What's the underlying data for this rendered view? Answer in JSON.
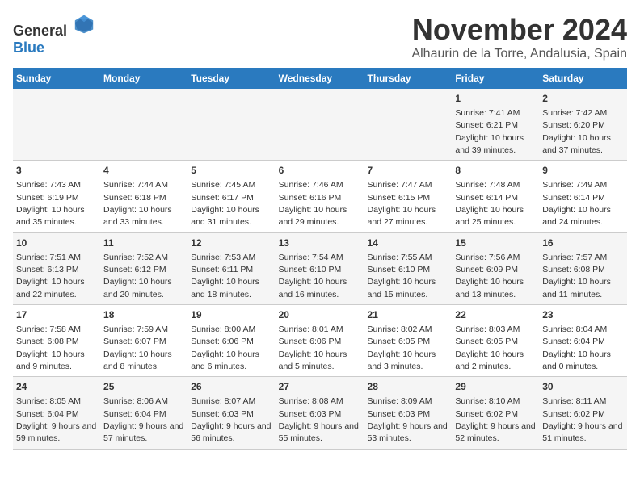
{
  "header": {
    "logo_general": "General",
    "logo_blue": "Blue",
    "month_title": "November 2024",
    "location": "Alhaurin de la Torre, Andalusia, Spain"
  },
  "columns": [
    "Sunday",
    "Monday",
    "Tuesday",
    "Wednesday",
    "Thursday",
    "Friday",
    "Saturday"
  ],
  "weeks": [
    {
      "cells": [
        {
          "day": "",
          "info": ""
        },
        {
          "day": "",
          "info": ""
        },
        {
          "day": "",
          "info": ""
        },
        {
          "day": "",
          "info": ""
        },
        {
          "day": "",
          "info": ""
        },
        {
          "day": "1",
          "info": "Sunrise: 7:41 AM\nSunset: 6:21 PM\nDaylight: 10 hours and 39 minutes."
        },
        {
          "day": "2",
          "info": "Sunrise: 7:42 AM\nSunset: 6:20 PM\nDaylight: 10 hours and 37 minutes."
        }
      ]
    },
    {
      "cells": [
        {
          "day": "3",
          "info": "Sunrise: 7:43 AM\nSunset: 6:19 PM\nDaylight: 10 hours and 35 minutes."
        },
        {
          "day": "4",
          "info": "Sunrise: 7:44 AM\nSunset: 6:18 PM\nDaylight: 10 hours and 33 minutes."
        },
        {
          "day": "5",
          "info": "Sunrise: 7:45 AM\nSunset: 6:17 PM\nDaylight: 10 hours and 31 minutes."
        },
        {
          "day": "6",
          "info": "Sunrise: 7:46 AM\nSunset: 6:16 PM\nDaylight: 10 hours and 29 minutes."
        },
        {
          "day": "7",
          "info": "Sunrise: 7:47 AM\nSunset: 6:15 PM\nDaylight: 10 hours and 27 minutes."
        },
        {
          "day": "8",
          "info": "Sunrise: 7:48 AM\nSunset: 6:14 PM\nDaylight: 10 hours and 25 minutes."
        },
        {
          "day": "9",
          "info": "Sunrise: 7:49 AM\nSunset: 6:14 PM\nDaylight: 10 hours and 24 minutes."
        }
      ]
    },
    {
      "cells": [
        {
          "day": "10",
          "info": "Sunrise: 7:51 AM\nSunset: 6:13 PM\nDaylight: 10 hours and 22 minutes."
        },
        {
          "day": "11",
          "info": "Sunrise: 7:52 AM\nSunset: 6:12 PM\nDaylight: 10 hours and 20 minutes."
        },
        {
          "day": "12",
          "info": "Sunrise: 7:53 AM\nSunset: 6:11 PM\nDaylight: 10 hours and 18 minutes."
        },
        {
          "day": "13",
          "info": "Sunrise: 7:54 AM\nSunset: 6:10 PM\nDaylight: 10 hours and 16 minutes."
        },
        {
          "day": "14",
          "info": "Sunrise: 7:55 AM\nSunset: 6:10 PM\nDaylight: 10 hours and 15 minutes."
        },
        {
          "day": "15",
          "info": "Sunrise: 7:56 AM\nSunset: 6:09 PM\nDaylight: 10 hours and 13 minutes."
        },
        {
          "day": "16",
          "info": "Sunrise: 7:57 AM\nSunset: 6:08 PM\nDaylight: 10 hours and 11 minutes."
        }
      ]
    },
    {
      "cells": [
        {
          "day": "17",
          "info": "Sunrise: 7:58 AM\nSunset: 6:08 PM\nDaylight: 10 hours and 9 minutes."
        },
        {
          "day": "18",
          "info": "Sunrise: 7:59 AM\nSunset: 6:07 PM\nDaylight: 10 hours and 8 minutes."
        },
        {
          "day": "19",
          "info": "Sunrise: 8:00 AM\nSunset: 6:06 PM\nDaylight: 10 hours and 6 minutes."
        },
        {
          "day": "20",
          "info": "Sunrise: 8:01 AM\nSunset: 6:06 PM\nDaylight: 10 hours and 5 minutes."
        },
        {
          "day": "21",
          "info": "Sunrise: 8:02 AM\nSunset: 6:05 PM\nDaylight: 10 hours and 3 minutes."
        },
        {
          "day": "22",
          "info": "Sunrise: 8:03 AM\nSunset: 6:05 PM\nDaylight: 10 hours and 2 minutes."
        },
        {
          "day": "23",
          "info": "Sunrise: 8:04 AM\nSunset: 6:04 PM\nDaylight: 10 hours and 0 minutes."
        }
      ]
    },
    {
      "cells": [
        {
          "day": "24",
          "info": "Sunrise: 8:05 AM\nSunset: 6:04 PM\nDaylight: 9 hours and 59 minutes."
        },
        {
          "day": "25",
          "info": "Sunrise: 8:06 AM\nSunset: 6:04 PM\nDaylight: 9 hours and 57 minutes."
        },
        {
          "day": "26",
          "info": "Sunrise: 8:07 AM\nSunset: 6:03 PM\nDaylight: 9 hours and 56 minutes."
        },
        {
          "day": "27",
          "info": "Sunrise: 8:08 AM\nSunset: 6:03 PM\nDaylight: 9 hours and 55 minutes."
        },
        {
          "day": "28",
          "info": "Sunrise: 8:09 AM\nSunset: 6:03 PM\nDaylight: 9 hours and 53 minutes."
        },
        {
          "day": "29",
          "info": "Sunrise: 8:10 AM\nSunset: 6:02 PM\nDaylight: 9 hours and 52 minutes."
        },
        {
          "day": "30",
          "info": "Sunrise: 8:11 AM\nSunset: 6:02 PM\nDaylight: 9 hours and 51 minutes."
        }
      ]
    }
  ]
}
